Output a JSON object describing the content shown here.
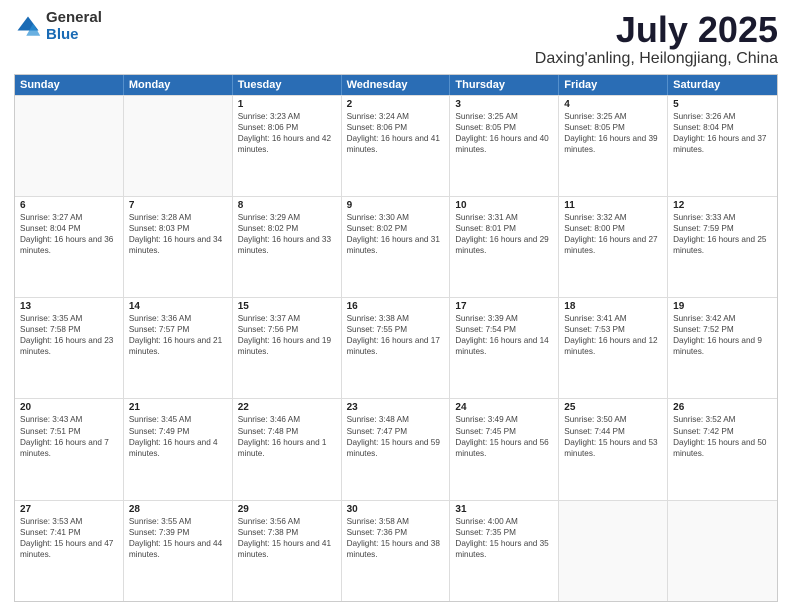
{
  "logo": {
    "general": "General",
    "blue": "Blue"
  },
  "title": "July 2025",
  "location": "Daxing'anling, Heilongjiang, China",
  "header_days": [
    "Sunday",
    "Monday",
    "Tuesday",
    "Wednesday",
    "Thursday",
    "Friday",
    "Saturday"
  ],
  "weeks": [
    [
      {
        "day": "",
        "sunrise": "",
        "sunset": "",
        "daylight": ""
      },
      {
        "day": "",
        "sunrise": "",
        "sunset": "",
        "daylight": ""
      },
      {
        "day": "1",
        "sunrise": "Sunrise: 3:23 AM",
        "sunset": "Sunset: 8:06 PM",
        "daylight": "Daylight: 16 hours and 42 minutes."
      },
      {
        "day": "2",
        "sunrise": "Sunrise: 3:24 AM",
        "sunset": "Sunset: 8:06 PM",
        "daylight": "Daylight: 16 hours and 41 minutes."
      },
      {
        "day": "3",
        "sunrise": "Sunrise: 3:25 AM",
        "sunset": "Sunset: 8:05 PM",
        "daylight": "Daylight: 16 hours and 40 minutes."
      },
      {
        "day": "4",
        "sunrise": "Sunrise: 3:25 AM",
        "sunset": "Sunset: 8:05 PM",
        "daylight": "Daylight: 16 hours and 39 minutes."
      },
      {
        "day": "5",
        "sunrise": "Sunrise: 3:26 AM",
        "sunset": "Sunset: 8:04 PM",
        "daylight": "Daylight: 16 hours and 37 minutes."
      }
    ],
    [
      {
        "day": "6",
        "sunrise": "Sunrise: 3:27 AM",
        "sunset": "Sunset: 8:04 PM",
        "daylight": "Daylight: 16 hours and 36 minutes."
      },
      {
        "day": "7",
        "sunrise": "Sunrise: 3:28 AM",
        "sunset": "Sunset: 8:03 PM",
        "daylight": "Daylight: 16 hours and 34 minutes."
      },
      {
        "day": "8",
        "sunrise": "Sunrise: 3:29 AM",
        "sunset": "Sunset: 8:02 PM",
        "daylight": "Daylight: 16 hours and 33 minutes."
      },
      {
        "day": "9",
        "sunrise": "Sunrise: 3:30 AM",
        "sunset": "Sunset: 8:02 PM",
        "daylight": "Daylight: 16 hours and 31 minutes."
      },
      {
        "day": "10",
        "sunrise": "Sunrise: 3:31 AM",
        "sunset": "Sunset: 8:01 PM",
        "daylight": "Daylight: 16 hours and 29 minutes."
      },
      {
        "day": "11",
        "sunrise": "Sunrise: 3:32 AM",
        "sunset": "Sunset: 8:00 PM",
        "daylight": "Daylight: 16 hours and 27 minutes."
      },
      {
        "day": "12",
        "sunrise": "Sunrise: 3:33 AM",
        "sunset": "Sunset: 7:59 PM",
        "daylight": "Daylight: 16 hours and 25 minutes."
      }
    ],
    [
      {
        "day": "13",
        "sunrise": "Sunrise: 3:35 AM",
        "sunset": "Sunset: 7:58 PM",
        "daylight": "Daylight: 16 hours and 23 minutes."
      },
      {
        "day": "14",
        "sunrise": "Sunrise: 3:36 AM",
        "sunset": "Sunset: 7:57 PM",
        "daylight": "Daylight: 16 hours and 21 minutes."
      },
      {
        "day": "15",
        "sunrise": "Sunrise: 3:37 AM",
        "sunset": "Sunset: 7:56 PM",
        "daylight": "Daylight: 16 hours and 19 minutes."
      },
      {
        "day": "16",
        "sunrise": "Sunrise: 3:38 AM",
        "sunset": "Sunset: 7:55 PM",
        "daylight": "Daylight: 16 hours and 17 minutes."
      },
      {
        "day": "17",
        "sunrise": "Sunrise: 3:39 AM",
        "sunset": "Sunset: 7:54 PM",
        "daylight": "Daylight: 16 hours and 14 minutes."
      },
      {
        "day": "18",
        "sunrise": "Sunrise: 3:41 AM",
        "sunset": "Sunset: 7:53 PM",
        "daylight": "Daylight: 16 hours and 12 minutes."
      },
      {
        "day": "19",
        "sunrise": "Sunrise: 3:42 AM",
        "sunset": "Sunset: 7:52 PM",
        "daylight": "Daylight: 16 hours and 9 minutes."
      }
    ],
    [
      {
        "day": "20",
        "sunrise": "Sunrise: 3:43 AM",
        "sunset": "Sunset: 7:51 PM",
        "daylight": "Daylight: 16 hours and 7 minutes."
      },
      {
        "day": "21",
        "sunrise": "Sunrise: 3:45 AM",
        "sunset": "Sunset: 7:49 PM",
        "daylight": "Daylight: 16 hours and 4 minutes."
      },
      {
        "day": "22",
        "sunrise": "Sunrise: 3:46 AM",
        "sunset": "Sunset: 7:48 PM",
        "daylight": "Daylight: 16 hours and 1 minute."
      },
      {
        "day": "23",
        "sunrise": "Sunrise: 3:48 AM",
        "sunset": "Sunset: 7:47 PM",
        "daylight": "Daylight: 15 hours and 59 minutes."
      },
      {
        "day": "24",
        "sunrise": "Sunrise: 3:49 AM",
        "sunset": "Sunset: 7:45 PM",
        "daylight": "Daylight: 15 hours and 56 minutes."
      },
      {
        "day": "25",
        "sunrise": "Sunrise: 3:50 AM",
        "sunset": "Sunset: 7:44 PM",
        "daylight": "Daylight: 15 hours and 53 minutes."
      },
      {
        "day": "26",
        "sunrise": "Sunrise: 3:52 AM",
        "sunset": "Sunset: 7:42 PM",
        "daylight": "Daylight: 15 hours and 50 minutes."
      }
    ],
    [
      {
        "day": "27",
        "sunrise": "Sunrise: 3:53 AM",
        "sunset": "Sunset: 7:41 PM",
        "daylight": "Daylight: 15 hours and 47 minutes."
      },
      {
        "day": "28",
        "sunrise": "Sunrise: 3:55 AM",
        "sunset": "Sunset: 7:39 PM",
        "daylight": "Daylight: 15 hours and 44 minutes."
      },
      {
        "day": "29",
        "sunrise": "Sunrise: 3:56 AM",
        "sunset": "Sunset: 7:38 PM",
        "daylight": "Daylight: 15 hours and 41 minutes."
      },
      {
        "day": "30",
        "sunrise": "Sunrise: 3:58 AM",
        "sunset": "Sunset: 7:36 PM",
        "daylight": "Daylight: 15 hours and 38 minutes."
      },
      {
        "day": "31",
        "sunrise": "Sunrise: 4:00 AM",
        "sunset": "Sunset: 7:35 PM",
        "daylight": "Daylight: 15 hours and 35 minutes."
      },
      {
        "day": "",
        "sunrise": "",
        "sunset": "",
        "daylight": ""
      },
      {
        "day": "",
        "sunrise": "",
        "sunset": "",
        "daylight": ""
      }
    ]
  ]
}
